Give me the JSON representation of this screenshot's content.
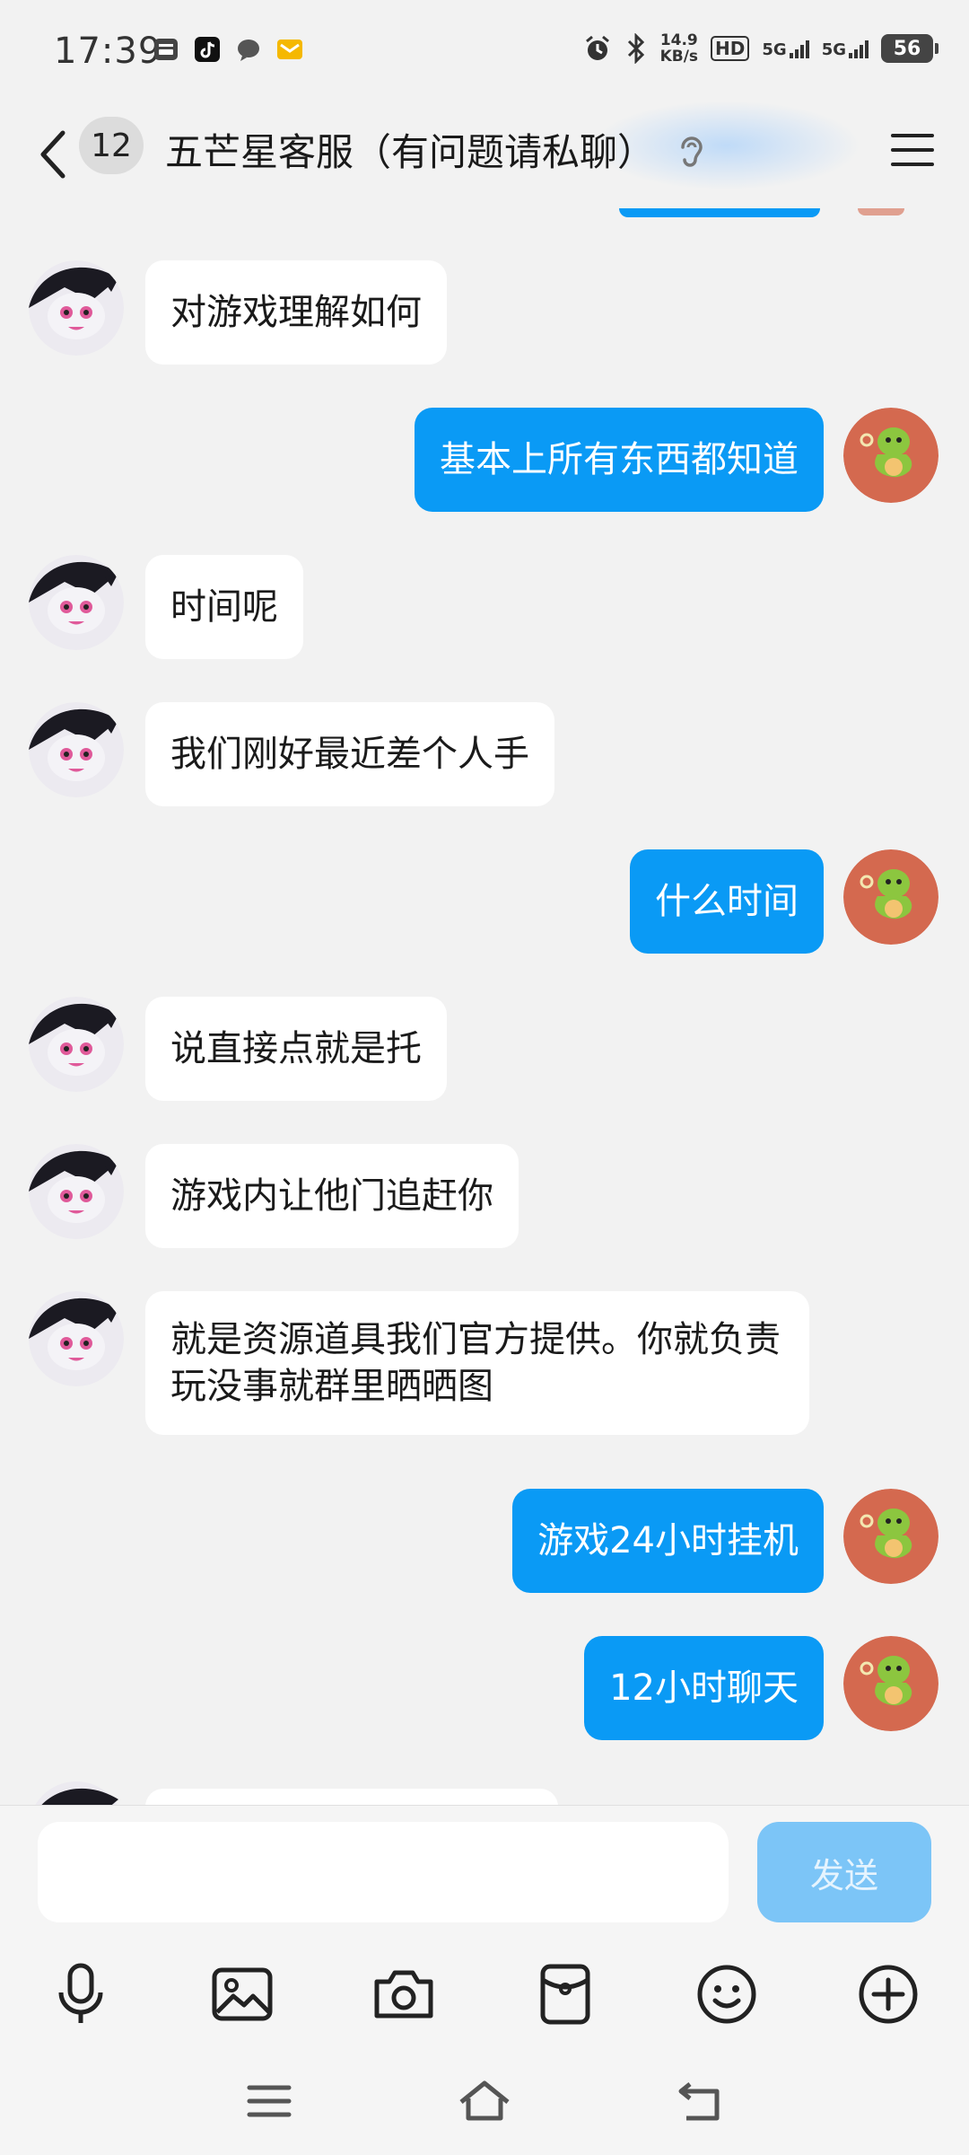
{
  "status_bar": {
    "time": "17:39",
    "speed_value": "14.9",
    "speed_unit": "KB/s",
    "hd_tag": "HD",
    "sim1_tag": "5G",
    "sim2_tag": "5G",
    "battery": "56",
    "app_icons": [
      "sms-box-icon",
      "tiktok-icon",
      "chat-bubble-icon",
      "mail-icon"
    ]
  },
  "header": {
    "unread_count": "12",
    "title": "五芒星客服（有问题请私聊）",
    "accent": "#0a9af5"
  },
  "messages": [
    {
      "side": "in",
      "text": "对游戏理解如何"
    },
    {
      "side": "out",
      "text": "基本上所有东西都知道"
    },
    {
      "side": "in",
      "text": "时间呢"
    },
    {
      "side": "in",
      "text": "我们刚好最近差个人手"
    },
    {
      "side": "out",
      "text": "什么时间"
    },
    {
      "side": "in",
      "text": "说直接点就是托"
    },
    {
      "side": "in",
      "text": "游戏内让他门追赶你"
    },
    {
      "side": "in",
      "text": "就是资源道具我们官方提供。你就负责玩没事就群里晒晒图"
    },
    {
      "side": "out",
      "text": "游戏24小时挂机"
    },
    {
      "side": "out",
      "text": "12小时聊天"
    }
  ],
  "input": {
    "value": "",
    "send_label": "发送"
  },
  "toolbar": [
    "microphone-icon",
    "image-icon",
    "camera-icon",
    "red-packet-icon",
    "emoji-icon",
    "plus-icon"
  ],
  "navbar": [
    "menu-icon",
    "home-icon",
    "back-icon"
  ]
}
